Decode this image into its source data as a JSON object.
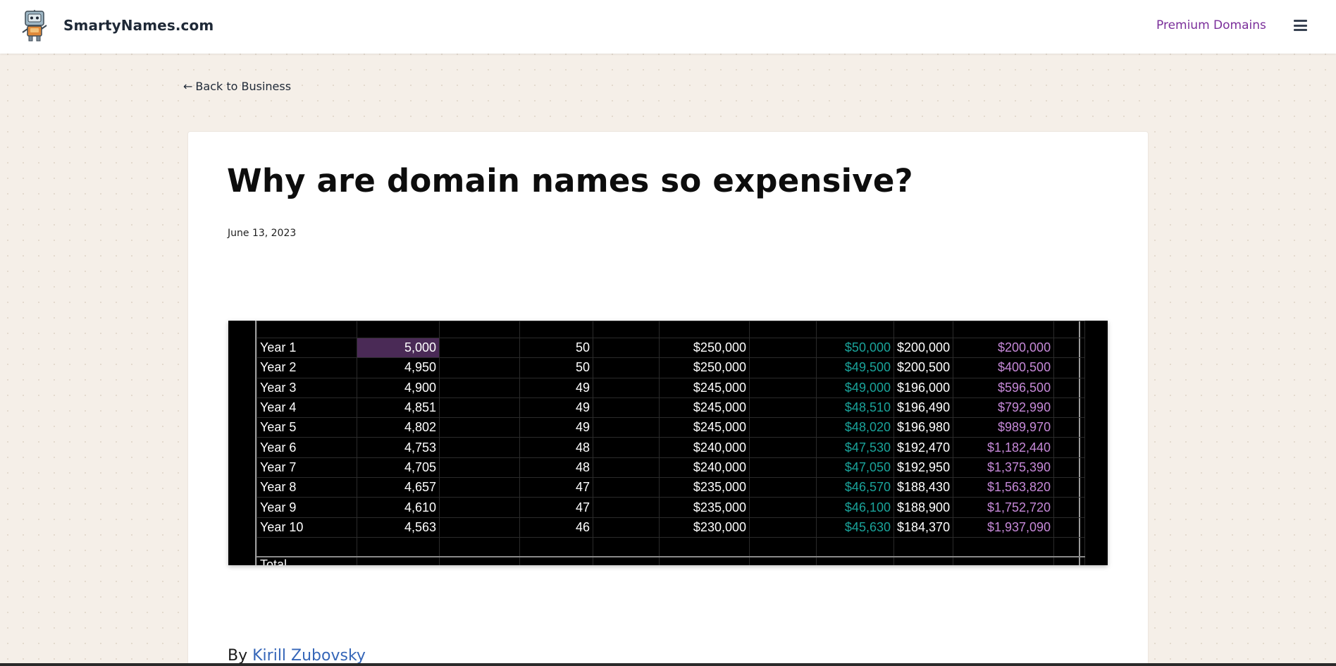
{
  "header": {
    "brand": "SmartyNames.com",
    "premium_link": "Premium Domains",
    "logo_icon": "robot-mascot-icon",
    "menu_icon": "hamburger-menu-icon"
  },
  "nav": {
    "back_arrow": "←",
    "back_label": "Back to Business"
  },
  "article": {
    "title": "Why are domain names so expensive?",
    "date": "June 13, 2023",
    "byline_prefix": "By",
    "author": "Kirill Zubovsky"
  },
  "spreadsheet": {
    "rows": [
      {
        "label": "Year 1",
        "a": "5,000",
        "b": "50",
        "c": "$250,000",
        "d": "$50,000",
        "e": "$200,000",
        "f": "$200,000"
      },
      {
        "label": "Year 2",
        "a": "4,950",
        "b": "50",
        "c": "$250,000",
        "d": "$49,500",
        "e": "$200,500",
        "f": "$400,500"
      },
      {
        "label": "Year 3",
        "a": "4,900",
        "b": "49",
        "c": "$245,000",
        "d": "$49,000",
        "e": "$196,000",
        "f": "$596,500"
      },
      {
        "label": "Year 4",
        "a": "4,851",
        "b": "49",
        "c": "$245,000",
        "d": "$48,510",
        "e": "$196,490",
        "f": "$792,990"
      },
      {
        "label": "Year 5",
        "a": "4,802",
        "b": "49",
        "c": "$245,000",
        "d": "$48,020",
        "e": "$196,980",
        "f": "$989,970"
      },
      {
        "label": "Year 6",
        "a": "4,753",
        "b": "48",
        "c": "$240,000",
        "d": "$47,530",
        "e": "$192,470",
        "f": "$1,182,440"
      },
      {
        "label": "Year 7",
        "a": "4,705",
        "b": "48",
        "c": "$240,000",
        "d": "$47,050",
        "e": "$192,950",
        "f": "$1,375,390"
      },
      {
        "label": "Year 8",
        "a": "4,657",
        "b": "47",
        "c": "$235,000",
        "d": "$46,570",
        "e": "$188,430",
        "f": "$1,563,820"
      },
      {
        "label": "Year 9",
        "a": "4,610",
        "b": "47",
        "c": "$235,000",
        "d": "$46,100",
        "e": "$188,900",
        "f": "$1,752,720"
      },
      {
        "label": "Year 10",
        "a": "4,563",
        "b": "46",
        "c": "$230,000",
        "d": "$45,630",
        "e": "$184,370",
        "f": "$1,937,090"
      }
    ],
    "total_label": "Total",
    "colors": {
      "teal": "#1aa39a",
      "violet": "#c689d8",
      "highlight": "#4a2a56"
    }
  },
  "colors": {
    "premium_link": "#7a2e9a",
    "author_link": "#3566b8",
    "page_bg": "#f5efe8"
  }
}
